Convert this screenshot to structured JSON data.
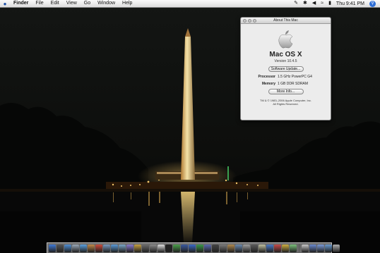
{
  "menubar": {
    "apple_icon": "apple-menu-icon",
    "items": [
      "Finder",
      "File",
      "Edit",
      "View",
      "Go",
      "Window",
      "Help"
    ],
    "clock": "Thu  9:41 PM",
    "status_icons": [
      "script-icon",
      "bluetooth-icon",
      "volume-icon",
      "wifi-icon",
      "battery-icon",
      "spotlight-icon"
    ]
  },
  "about_window": {
    "title": "About This Mac",
    "os_name": "Mac OS X",
    "version": "Version 10.4.5",
    "software_update_label": "Software Update...",
    "processor_label": "Processor",
    "processor_value": "1.5 GHz PowerPC G4",
    "memory_label": "Memory",
    "memory_value": "1 GB DDR SDRAM",
    "more_info_label": "More Info...",
    "copyright_line1": "TM & © 1983–2006 Apple Computer, Inc.",
    "copyright_line2": "All Rights Reserved."
  },
  "dock": {
    "items": [
      {
        "name": "finder-icon",
        "color": "#3f7ad8"
      },
      {
        "name": "dashboard-icon",
        "color": "#555555"
      },
      {
        "name": "safari-icon",
        "color": "#4f8fd6"
      },
      {
        "name": "mail-icon",
        "color": "#9aa9b8"
      },
      {
        "name": "ichat-icon",
        "color": "#5aa0e0"
      },
      {
        "name": "address-book-icon",
        "color": "#c28a4a"
      },
      {
        "name": "ical-icon",
        "color": "#d04a3a"
      },
      {
        "name": "preview-icon",
        "color": "#7a9ac0"
      },
      {
        "name": "itunes-icon",
        "color": "#5a9ad8"
      },
      {
        "name": "iphoto-icon",
        "color": "#7aa6c8"
      },
      {
        "name": "imovie-icon",
        "color": "#8a7ad0"
      },
      {
        "name": "garageband-icon",
        "color": "#c8a040"
      },
      {
        "name": "idvd-icon",
        "color": "#6c6c6c"
      },
      {
        "name": "system-preferences-icon",
        "color": "#8a8a8a"
      },
      {
        "name": "textedit-icon",
        "color": "#e0e0e0"
      },
      {
        "name": "terminal-icon",
        "color": "#222222"
      },
      {
        "name": "activity-monitor-icon",
        "color": "#4aa04a"
      },
      {
        "name": "photoshop-icon",
        "color": "#3a5aa0"
      },
      {
        "name": "word-icon",
        "color": "#3a6ac8"
      },
      {
        "name": "excel-icon",
        "color": "#3a9a4a"
      },
      {
        "name": "quicktime-icon",
        "color": "#5a6ab0"
      },
      {
        "name": "dvd-player-icon",
        "color": "#444444"
      },
      {
        "name": "calculator-icon",
        "color": "#7a7a7a"
      },
      {
        "name": "sherlock-icon",
        "color": "#b08a50"
      },
      {
        "name": "network-utility-icon",
        "color": "#6a8ab0"
      },
      {
        "name": "disk-utility-icon",
        "color": "#a0a0a0"
      },
      {
        "name": "console-icon",
        "color": "#5a5a5a"
      },
      {
        "name": "font-book-icon",
        "color": "#c0c0a0"
      },
      {
        "name": "app-icon",
        "color": "#4a7ac8"
      },
      {
        "name": "app-icon",
        "color": "#c84a4a"
      },
      {
        "name": "app-icon",
        "color": "#d0b040"
      },
      {
        "name": "app-icon",
        "color": "#7ac07a"
      }
    ],
    "minimized": [
      {
        "name": "minimized-window-icon",
        "color": "#c8c8c8"
      },
      {
        "name": "minimized-window-icon",
        "color": "#6a8ad0"
      },
      {
        "name": "documents-folder-icon",
        "color": "#7a9ad8"
      },
      {
        "name": "downloads-folder-icon",
        "color": "#6a9ad0"
      },
      {
        "name": "trash-icon",
        "color": "#b0b0b0"
      }
    ]
  }
}
